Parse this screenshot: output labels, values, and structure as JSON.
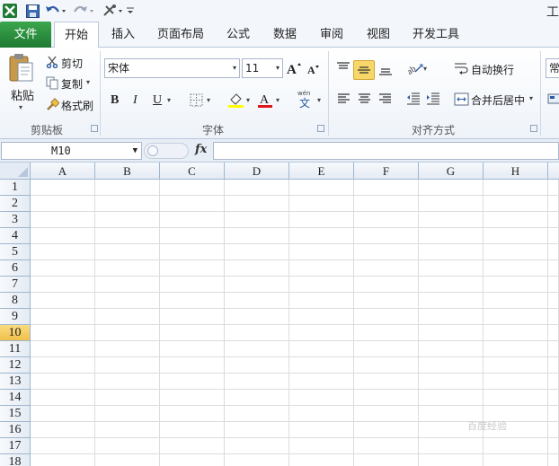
{
  "title_bar": {
    "app_title": "工"
  },
  "tabs": [
    {
      "label": "文件"
    },
    {
      "label": "开始"
    },
    {
      "label": "插入"
    },
    {
      "label": "页面布局"
    },
    {
      "label": "公式"
    },
    {
      "label": "数据"
    },
    {
      "label": "审阅"
    },
    {
      "label": "视图"
    },
    {
      "label": "开发工具"
    }
  ],
  "clipboard": {
    "paste_label": "粘贴",
    "cut_label": "剪切",
    "copy_label": "复制",
    "format_painter_label": "格式刷",
    "group_label": "剪贴板"
  },
  "font": {
    "font_name": "宋体",
    "font_size": "11",
    "bold": "B",
    "italic": "I",
    "underline": "U",
    "group_label": "字体"
  },
  "alignment": {
    "wrap_text_label": "自动换行",
    "merge_center_label": "合并后居中",
    "group_label": "对齐方式"
  },
  "number": {
    "format_value": "常"
  },
  "formula_bar": {
    "name_box": "M10",
    "fx": "fx",
    "formula": ""
  },
  "sheet": {
    "columns": [
      "A",
      "B",
      "C",
      "D",
      "E",
      "F",
      "G",
      "H"
    ],
    "rows": [
      "1",
      "2",
      "3",
      "4",
      "5",
      "6",
      "7",
      "8",
      "9",
      "10",
      "11",
      "12",
      "13",
      "14",
      "15",
      "16",
      "17",
      "18"
    ],
    "active_row": "10"
  },
  "colors": {
    "file_tab": "#2a8a3e",
    "active_row_header": "#f5c94a",
    "ribbon_border": "#b8c9de"
  },
  "watermark": {
    "text": "百度经验"
  }
}
